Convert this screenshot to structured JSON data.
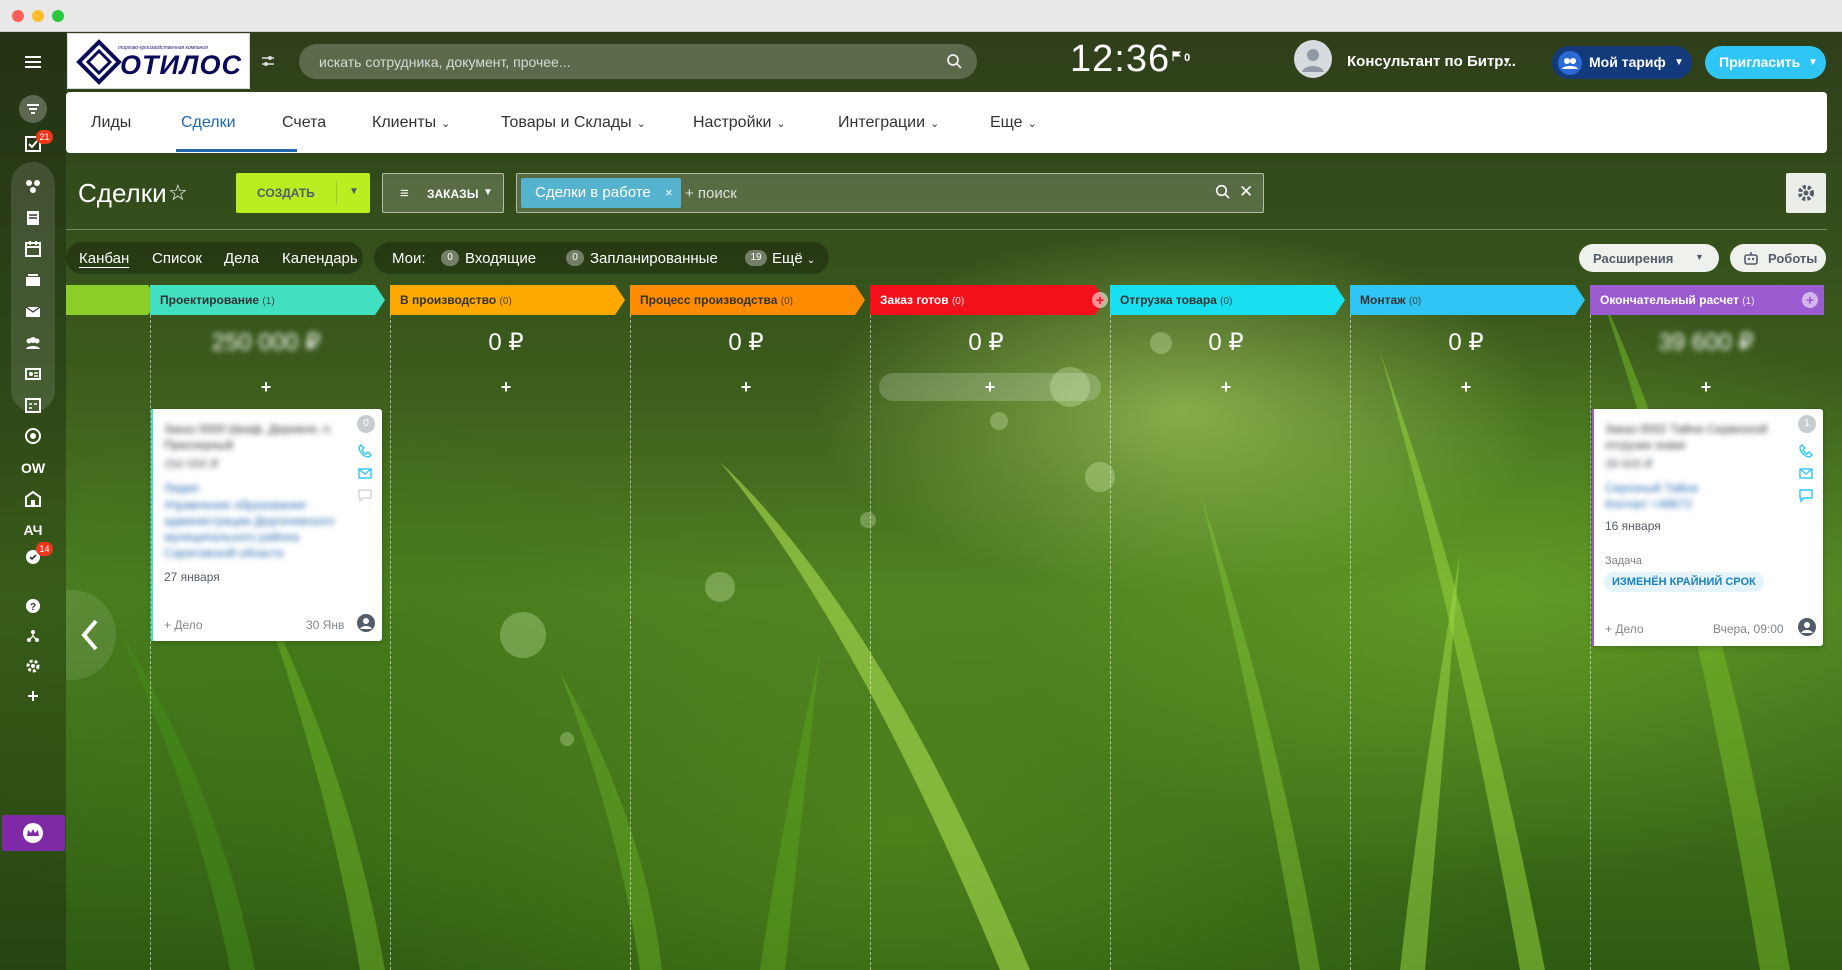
{
  "window": {
    "dots": [
      "#ff5f56",
      "#ffbd2e",
      "#27c93f"
    ]
  },
  "header": {
    "logo_tiny": "торгово-производственная компания",
    "logo_name": "ОТИЛОС",
    "search_placeholder": "искать сотрудника, документ, прочее...",
    "clock": "12:36",
    "flag_count": "0",
    "user_name": "Консультант по Битр...",
    "tariff_label": "Мой тариф",
    "invite_label": "Пригласить"
  },
  "sidebar": {
    "badge_tasks": "21",
    "badge_check": "14",
    "label_ow": "OW",
    "label_ach": "АЧ"
  },
  "nav": {
    "items": [
      "Лиды",
      "Сделки",
      "Счета",
      "Клиенты",
      "Товары и Склады",
      "Настройки",
      "Интеграции",
      "Еще"
    ]
  },
  "toolbar": {
    "page_title": "Сделки",
    "create_label": "СОЗДАТЬ",
    "orders_label": "ЗАКАЗЫ",
    "filter_tag": "Сделки в работе",
    "filter_search_placeholder": "+ поиск"
  },
  "views": {
    "items": [
      "Канбан",
      "Список",
      "Дела",
      "Календарь"
    ],
    "my_label": "Мои:",
    "incoming_count": "0",
    "incoming_label": "Входящие",
    "planned_count": "0",
    "planned_label": "Запланированные",
    "more_count": "19",
    "more_label": "Ещё",
    "extensions_label": "Расширения",
    "robots_label": "Роботы"
  },
  "kanban": {
    "columns": [
      {
        "title": "Проектирование",
        "count": "(1)",
        "sum": "250 000 ₽",
        "color": "#40e0c0"
      },
      {
        "title": "В производство",
        "count": "(0)",
        "sum": "0 ₽",
        "color": "#ffa900"
      },
      {
        "title": "Процесс производства",
        "count": "(0)",
        "sum": "0 ₽",
        "color": "#ff8c00"
      },
      {
        "title": "Заказ готов",
        "count": "(0)",
        "sum": "0 ₽",
        "color": "#f2111b"
      },
      {
        "title": "Отгрузка товара",
        "count": "(0)",
        "sum": "0 ₽",
        "color": "#18e0f0"
      },
      {
        "title": "Монтаж",
        "count": "(0)",
        "sum": "0 ₽",
        "color": "#2fc6f6"
      },
      {
        "title": "Окончательный расчет",
        "count": "(1)",
        "sum": "39 600 ₽",
        "color": "#9b5bd0"
      }
    ],
    "card1": {
      "badge": "0",
      "title": "Заказ 0000 Шкаф, Деревня, п. Приозерный",
      "sum": "250 000 ₽",
      "client": "Лидия",
      "org": "Управление образования администрации Дергачевского муниципального района Саратовской области",
      "date": "27 января",
      "add_task": "+ Дело",
      "deadline": "30 Янв"
    },
    "card2": {
      "badge": "1",
      "title": "Заказ 0002 Тайна Сервизной отгрузки знаки",
      "sum": "39 600 ₽",
      "client": "Серозный Тайна",
      "contact": "Контакт +48672",
      "date": "16 января",
      "task_label": "Задача",
      "task_tag": "ИЗМЕНЁН КРАЙНИЙ СРОК",
      "add_task": "+ Дело",
      "deadline": "Вчера, 09:00"
    }
  }
}
